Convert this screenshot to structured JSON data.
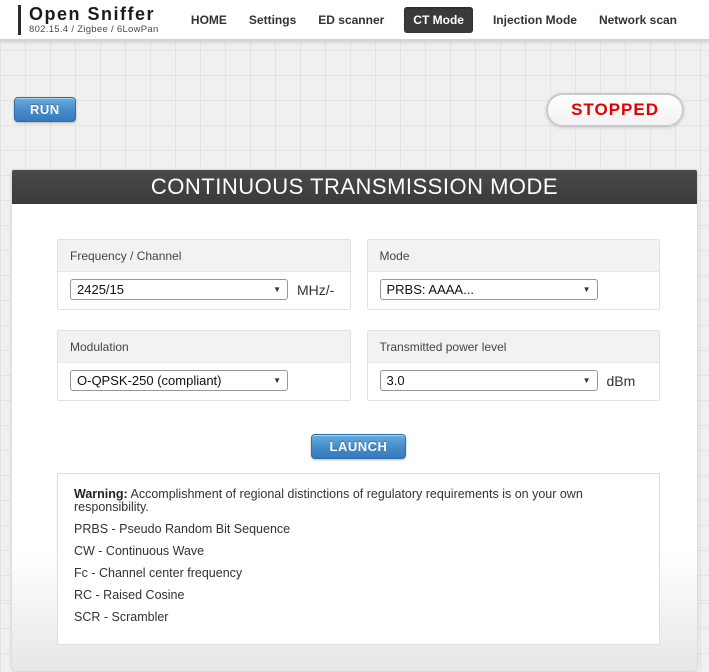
{
  "header": {
    "logo": {
      "title": "Open Sniffer",
      "subtitle": "802.15.4 / Zigbee / 6LowPan"
    },
    "nav": [
      {
        "label": "HOME",
        "active": false
      },
      {
        "label": "Settings",
        "active": false
      },
      {
        "label": "ED scanner",
        "active": false
      },
      {
        "label": "CT Mode",
        "active": true
      },
      {
        "label": "Injection Mode",
        "active": false
      },
      {
        "label": "Network scan",
        "active": false
      }
    ]
  },
  "toolbar": {
    "run_label": "RUN",
    "status": "STOPPED"
  },
  "panel": {
    "title": "CONTINUOUS TRANSMISSION MODE",
    "fields": [
      {
        "label": "Frequency / Channel",
        "value": "2425/15",
        "unit": "MHz/-"
      },
      {
        "label": "Mode",
        "value": "PRBS: AAAA...",
        "unit": ""
      },
      {
        "label": "Modulation",
        "value": "O-QPSK-250 (compliant)",
        "unit": ""
      },
      {
        "label": "Transmitted power level",
        "value": "3.0",
        "unit": "dBm"
      }
    ],
    "launch_label": "LAUNCH",
    "notes": {
      "warning_label": "Warning:",
      "warning_text": " Accomplishment of regional distinctions of regulatory requirements is on your own responsibility.",
      "abbreviations": [
        "PRBS - Pseudo Random Bit Sequence",
        "CW - Continuous Wave",
        "Fc - Channel center frequency",
        "RC - Raised Cosine",
        "SCR - Scrambler"
      ]
    }
  },
  "colors": {
    "accent_blue": "#3379bd",
    "status_red": "#e60000",
    "nav_active_bg": "#3a3a3a",
    "panel_header_bg": "#3d3d3d"
  }
}
